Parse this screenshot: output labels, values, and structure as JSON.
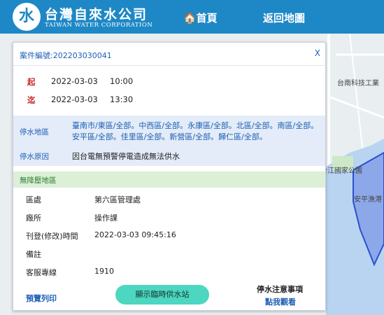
{
  "header": {
    "logo_glyph": "水",
    "brand_zh": "台灣自來水公司",
    "brand_en": "TAIWAN WATER CORPORATION",
    "nav_home": "🏠首頁",
    "nav_map": "返回地圖"
  },
  "map": {
    "labels": [
      "台南科技工業",
      "台江國家公園",
      "安平漁港"
    ]
  },
  "popup": {
    "case_no": "案件編號:202203030041",
    "close": "X",
    "start": {
      "key": "起",
      "date": "2022-03-03",
      "time": "10:00"
    },
    "end": {
      "key": "迄",
      "date": "2022-03-03",
      "time": "13:30"
    },
    "area_label": "停水地區",
    "area_text": "臺南市/東區/全部。中西區/全部。永康區/全部。北區/全部。南區/全部。安平區/全部。佳里區/全部。新營區/全部。歸仁區/全部。",
    "reason_label": "停水原因",
    "reason_text": "因台電無預警停電造成無法供水",
    "no_pressure_label": "無降壓地區",
    "info": [
      {
        "label": "區處",
        "value": "第六區管理處"
      },
      {
        "label": "廠所",
        "value": "操作課"
      },
      {
        "label": "刊登(修改)時間",
        "value": "2022-03-03 09:45:16"
      },
      {
        "label": "備註",
        "value": ""
      },
      {
        "label": "客服專線",
        "value": "1910"
      }
    ],
    "print_link": "預覽列印",
    "station_button": "顯示臨時供水站",
    "notice_title": "停水注意事項",
    "notice_link": "點我觀看"
  },
  "colors": {
    "header_bg": "#1e88c6",
    "link_blue": "#1e5fb4",
    "red_key": "#c62828",
    "area_bg": "#e3ecf8",
    "no_pressure_bg": "#dcefd7",
    "button_bg": "#4dd6c0"
  }
}
